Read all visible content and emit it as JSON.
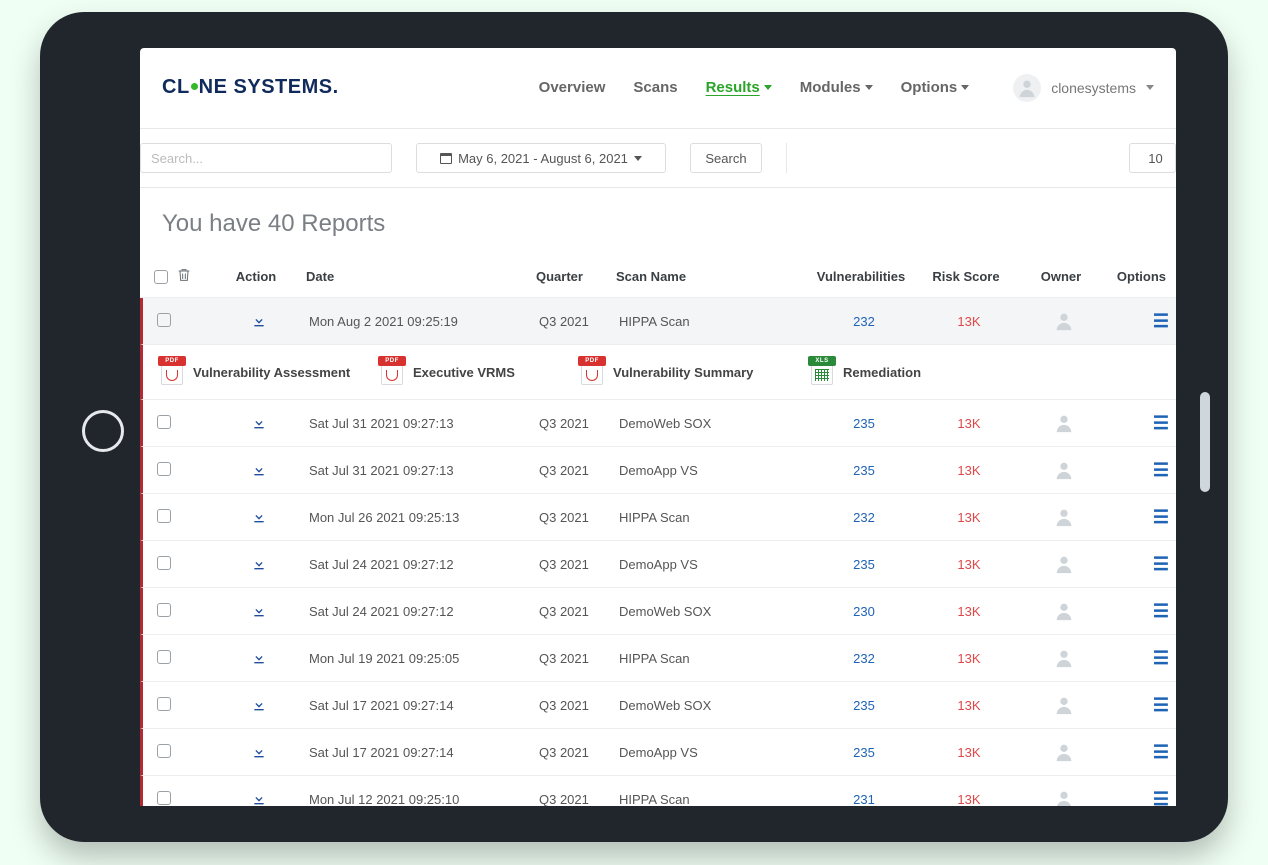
{
  "brand": {
    "name_part1": "CL",
    "name_part2": "NE SYSTEMS."
  },
  "nav": {
    "overview": "Overview",
    "scans": "Scans",
    "results": "Results",
    "modules": "Modules",
    "options": "Options"
  },
  "user": {
    "name": "clonesystems"
  },
  "filters": {
    "search_placeholder": "Search...",
    "date_range": "May 6, 2021 - August 6, 2021",
    "search_btn": "Search",
    "page_size": "10"
  },
  "page": {
    "title": "You have 40 Reports"
  },
  "columns": {
    "action": "Action",
    "date": "Date",
    "quarter": "Quarter",
    "scan_name": "Scan Name",
    "vulnerabilities": "Vulnerabilities",
    "risk_score": "Risk Score",
    "owner": "Owner",
    "options": "Options"
  },
  "report_types": {
    "r0": "Vulnerability Assessment",
    "r1": "Executive VRMS",
    "r2": "Vulnerability Summary",
    "r3": "Remediation"
  },
  "rows": [
    {
      "date": "Mon Aug 2 2021 09:25:19",
      "quarter": "Q3 2021",
      "name": "HIPPA Scan",
      "vuln": "232",
      "risk": "13K"
    },
    {
      "date": "Sat Jul 31 2021 09:27:13",
      "quarter": "Q3 2021",
      "name": "DemoWeb SOX",
      "vuln": "235",
      "risk": "13K"
    },
    {
      "date": "Sat Jul 31 2021 09:27:13",
      "quarter": "Q3 2021",
      "name": "DemoApp VS",
      "vuln": "235",
      "risk": "13K"
    },
    {
      "date": "Mon Jul 26 2021 09:25:13",
      "quarter": "Q3 2021",
      "name": "HIPPA Scan",
      "vuln": "232",
      "risk": "13K"
    },
    {
      "date": "Sat Jul 24 2021 09:27:12",
      "quarter": "Q3 2021",
      "name": "DemoApp VS",
      "vuln": "235",
      "risk": "13K"
    },
    {
      "date": "Sat Jul 24 2021 09:27:12",
      "quarter": "Q3 2021",
      "name": "DemoWeb SOX",
      "vuln": "230",
      "risk": "13K"
    },
    {
      "date": "Mon Jul 19 2021 09:25:05",
      "quarter": "Q3 2021",
      "name": "HIPPA Scan",
      "vuln": "232",
      "risk": "13K"
    },
    {
      "date": "Sat Jul 17 2021 09:27:14",
      "quarter": "Q3 2021",
      "name": "DemoWeb SOX",
      "vuln": "235",
      "risk": "13K"
    },
    {
      "date": "Sat Jul 17 2021 09:27:14",
      "quarter": "Q3 2021",
      "name": "DemoApp VS",
      "vuln": "235",
      "risk": "13K"
    },
    {
      "date": "Mon Jul 12 2021 09:25:10",
      "quarter": "Q3 2021",
      "name": "HIPPA Scan",
      "vuln": "231",
      "risk": "13K"
    }
  ]
}
